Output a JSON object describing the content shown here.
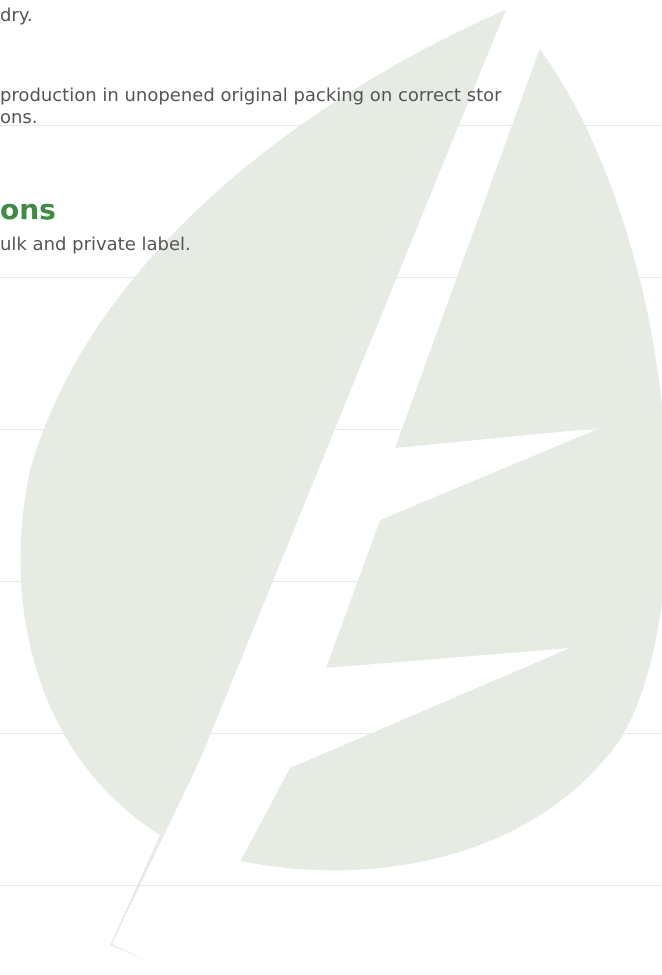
{
  "colors": {
    "heading": "#3f8a44",
    "body_text": "#555555",
    "watermark": "#e6ebe4"
  },
  "icons": {
    "watermark": "leaf-icon"
  },
  "storage": {
    "line1": "dry.",
    "line2": "production in unopened original packing on correct stor",
    "line3": "ons."
  },
  "section": {
    "heading": "ons",
    "text": "ulk and private label."
  }
}
